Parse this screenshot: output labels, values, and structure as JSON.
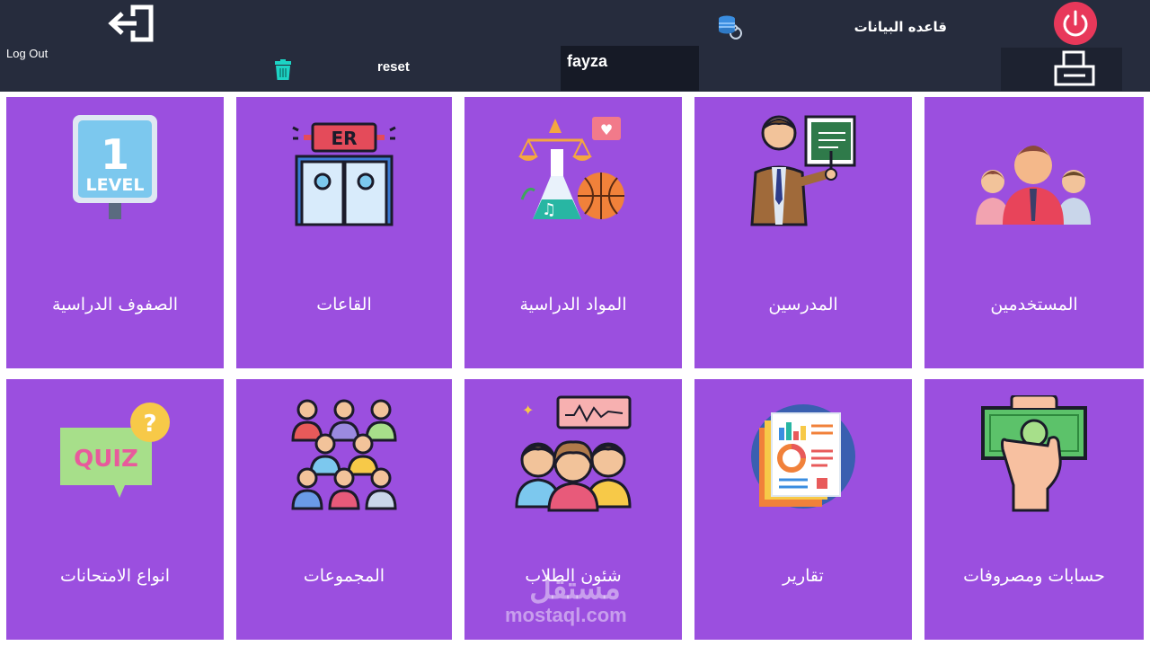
{
  "header": {
    "logout_label": "Log Out",
    "reset_label": "reset",
    "username": "fayza",
    "database_label": "قاعده البيانات",
    "icons": {
      "logout": "logout-arrow-icon",
      "trash": "trash-icon",
      "database": "database-sync-icon",
      "power": "power-icon",
      "print": "printer-icon"
    },
    "colors": {
      "background": "#262c3d",
      "user_box": "#161a26",
      "power": "#e8385a",
      "trash": "#1dd3c4"
    }
  },
  "tiles": {
    "row1": [
      {
        "label": "الصفوف الدراسية",
        "icon": "level-1-sign-icon"
      },
      {
        "label": "القاعات",
        "icon": "er-door-icon"
      },
      {
        "label": "المواد الدراسية",
        "icon": "subjects-icon"
      },
      {
        "label": "المدرسين",
        "icon": "teacher-icon"
      },
      {
        "label": "المستخدمين",
        "icon": "users-group-icon"
      }
    ],
    "row2": [
      {
        "label": "انواع الامتحانات",
        "icon": "quiz-icon"
      },
      {
        "label": "المجموعات",
        "icon": "groups-icon"
      },
      {
        "label": "شئون الطلاب",
        "icon": "students-affairs-icon"
      },
      {
        "label": "تقارير",
        "icon": "reports-icon"
      },
      {
        "label": "حسابات ومصروفات",
        "icon": "money-hand-icon"
      }
    ],
    "color": "#9b4fdf"
  },
  "watermark": {
    "text": "مستقل",
    "site": "mostaql.com"
  }
}
